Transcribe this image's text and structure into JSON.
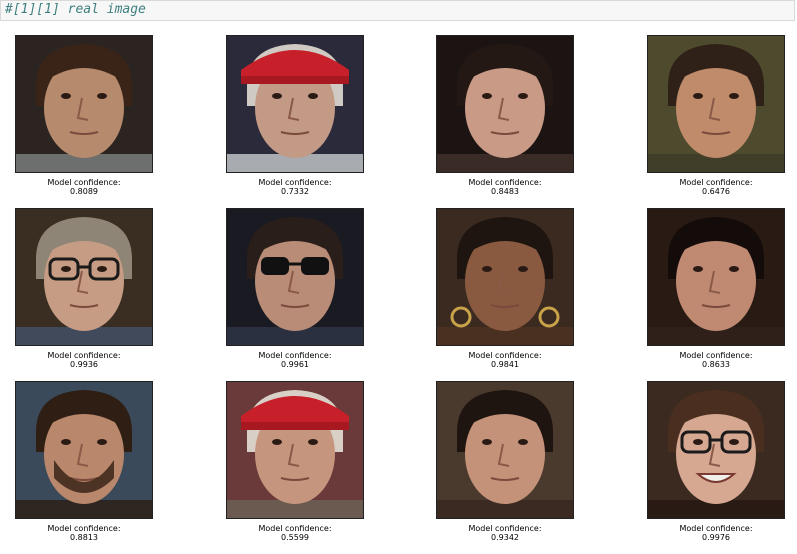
{
  "cell": {
    "code_comment": "#[1][1] real image"
  },
  "images": [
    {
      "label": "Model confidence:",
      "value": "0.8089",
      "bg": "#2b2420",
      "skin": "#b68a6d",
      "hair": "#3a2418",
      "shirt": "#6c6f6e",
      "accent": "none"
    },
    {
      "label": "Model confidence:",
      "value": "0.7332",
      "bg": "#2a2a3a",
      "skin": "#c29a85",
      "hair": "#cfcac4",
      "shirt": "#a8acb0",
      "accent": "redcap"
    },
    {
      "label": "Model confidence:",
      "value": "0.8483",
      "bg": "#1b1412",
      "skin": "#c99a86",
      "hair": "#241815",
      "shirt": "#3a2b27",
      "accent": "none"
    },
    {
      "label": "Model confidence:",
      "value": "0.6476",
      "bg": "#4d4a2d",
      "skin": "#c08b6a",
      "hair": "#2f2118",
      "shirt": "#403d28",
      "accent": "none"
    },
    {
      "label": "Model confidence:",
      "value": "0.9936",
      "bg": "#3a2e22",
      "skin": "#c79c84",
      "hair": "#8f8576",
      "shirt": "#404a5a",
      "accent": "glasses"
    },
    {
      "label": "Model confidence:",
      "value": "0.9961",
      "bg": "#1a1b22",
      "skin": "#b88c76",
      "hair": "#2a1e1a",
      "shirt": "#2b3040",
      "accent": "sunglasses"
    },
    {
      "label": "Model confidence:",
      "value": "0.9841",
      "bg": "#3a2a20",
      "skin": "#8a5a40",
      "hair": "#1e1410",
      "shirt": "#4a3020",
      "accent": "earrings"
    },
    {
      "label": "Model confidence:",
      "value": "0.8633",
      "bg": "#2a1a14",
      "skin": "#c08a72",
      "hair": "#140c0a",
      "shirt": "#30201a",
      "accent": "none"
    },
    {
      "label": "Model confidence:",
      "value": "0.8813",
      "bg": "#3a4a5a",
      "skin": "#b9876b",
      "hair": "#2e1e14",
      "shirt": "#2e2620",
      "accent": "beard"
    },
    {
      "label": "Model confidence:",
      "value": "0.5599",
      "bg": "#6a3a3a",
      "skin": "#c6957e",
      "hair": "#d8d0c6",
      "shirt": "#6a5a50",
      "accent": "redcap"
    },
    {
      "label": "Model confidence:",
      "value": "0.9342",
      "bg": "#4a3a2e",
      "skin": "#c49279",
      "hair": "#1e1410",
      "shirt": "#3a2a22",
      "accent": "none"
    },
    {
      "label": "Model confidence:",
      "value": "0.9976",
      "bg": "#3a2a20",
      "skin": "#d6a892",
      "hair": "#4a2e20",
      "shirt": "#2a1a14",
      "accent": "glasses-smile"
    }
  ]
}
